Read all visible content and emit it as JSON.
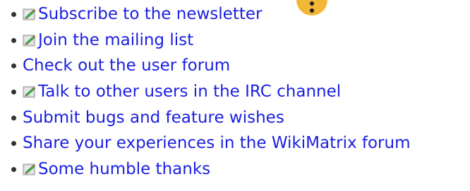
{
  "links": [
    {
      "label": "Subscribe to the newsletter",
      "icon": "wiki-edit-icon"
    },
    {
      "label": "Join the mailing list",
      "icon": "wiki-edit-icon"
    },
    {
      "label": "Check out the user forum",
      "icon": ""
    },
    {
      "label": "Talk to other users in the IRC channel",
      "icon": "wiki-edit-icon"
    },
    {
      "label": "Submit bugs and feature wishes",
      "icon": ""
    },
    {
      "label": "Share your experiences in the WikiMatrix forum",
      "icon": ""
    },
    {
      "label": "Some humble thanks",
      "icon": "wiki-edit-icon"
    }
  ],
  "colors": {
    "link": "#1a1fe0",
    "bullet": "#333333",
    "badge": "#f2b736"
  },
  "badge_icon": "more-vertical-icon"
}
